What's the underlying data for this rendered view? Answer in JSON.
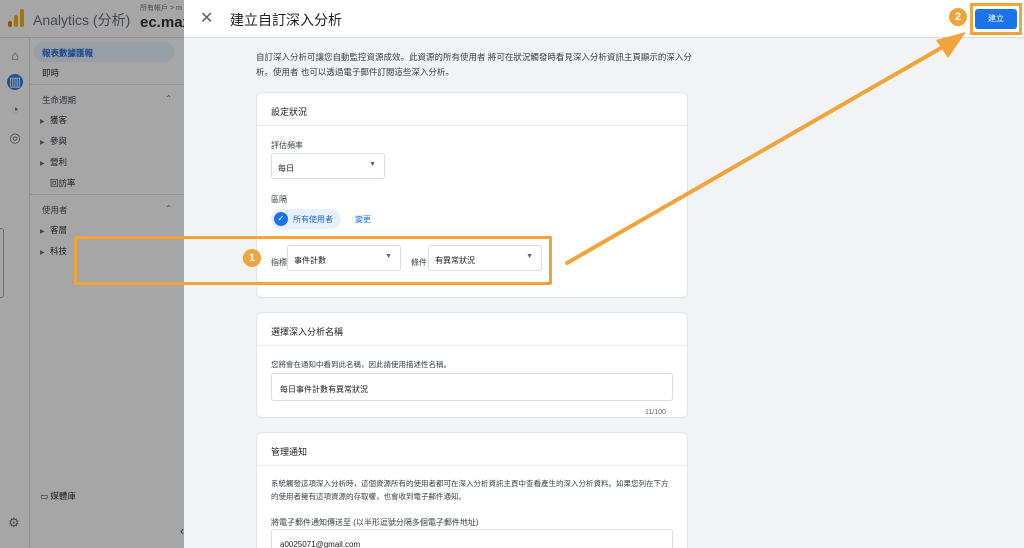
{
  "app": {
    "title": "Analytics (分析)",
    "account_crumb": "所有帳戶 > m",
    "property_name": "ec.maxl"
  },
  "sidebar": {
    "items": {
      "reports_snapshot": "報表數據匯報",
      "realtime": "即時",
      "lifecycle": "生命週期",
      "acquisition": "獲客",
      "engagement": "參與",
      "monetization": "營利",
      "retention": "回訪率",
      "user": "使用者",
      "demographics": "客層",
      "tech": "科技",
      "library": "媒體庫"
    }
  },
  "dialog": {
    "title": "建立自訂深入分析",
    "create_label": "建立",
    "intro": "自訂深入分析可讓您自動監控資源成效。此資源的所有使用者 將可在狀況觸發時看見深入分析資訊主頁顯示的深入分析。使用者 也可以透過電子郵件訂閱這些深入分析。",
    "conditions": {
      "title": "設定狀況",
      "frequency_label": "評估頻率",
      "frequency_value": "每日",
      "segment_label": "區隔",
      "segment_value": "所有使用者",
      "change_link": "變更",
      "metric_label": "指標",
      "metric_value": "事件計數",
      "condition_label": "條件",
      "condition_value": "有異常狀況"
    },
    "name_section": {
      "title": "選擇深入分析名稱",
      "hint": "您將會在通知中看到此名稱，因此請使用描述性名稱。",
      "value": "每日事件計數有異常狀況",
      "counter": "11/100"
    },
    "notify_section": {
      "title": "管理通知",
      "desc": "系統觸發這項深入分析時，這個資源所有的使用者都可在深入分析資訊主頁中查看產生的深入分析資料。如果您列在下方的使用者擁有這項資源的存取權，也會收到電子郵件通知。",
      "email_label": "將電子郵件通知傳送至 (以半形逗號分隔多個電子郵件地址)",
      "email_value": "a0025071@gmail.com"
    }
  },
  "annotations": {
    "step1": "1",
    "step2": "2",
    "highlight_color": "#f2a33a"
  }
}
